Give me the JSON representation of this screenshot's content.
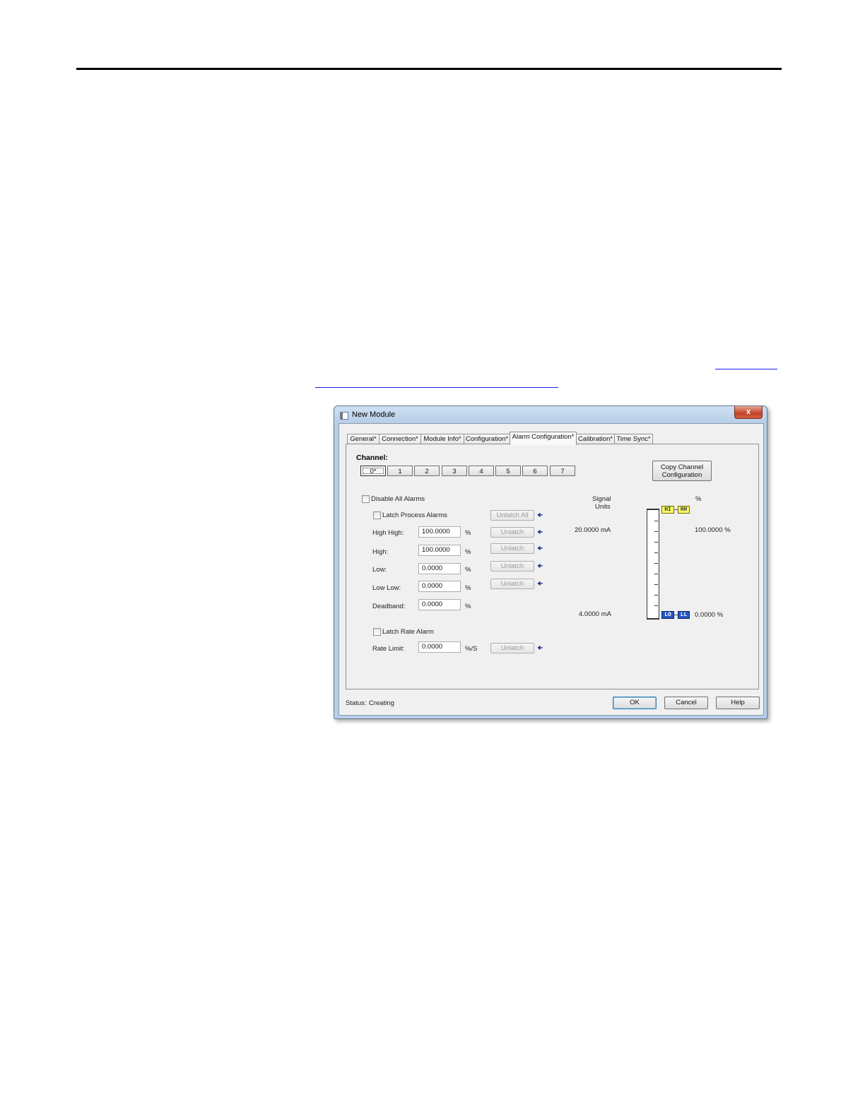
{
  "window": {
    "title": "New Module",
    "close_glyph": "x"
  },
  "tabs": [
    "General*",
    "Connection*",
    "Module Info*",
    "Configuration*",
    "Alarm Configuration*",
    "Calibration*",
    "Time Sync*"
  ],
  "active_tab": "Alarm Configuration*",
  "channel": {
    "label": "Channel:",
    "buttons": [
      "0*",
      "1",
      "2",
      "3",
      "4",
      "5",
      "6",
      "7"
    ],
    "selected": "0*"
  },
  "copy_button": {
    "line1": "Copy Channel",
    "line2": "Configuration"
  },
  "alarms": {
    "disable_all": "Disable All Alarms",
    "latch_process": "Latch Process Alarms",
    "unlatch_all": "Unlatch All",
    "unlatch": "Unlatch",
    "high_high": {
      "label": "High High:",
      "value": "100.0000",
      "unit": "%"
    },
    "high": {
      "label": "High:",
      "value": "100.0000",
      "unit": "%"
    },
    "low": {
      "label": "Low:",
      "value": "0.0000",
      "unit": "%"
    },
    "low_low": {
      "label": "Low Low:",
      "value": "0.0000",
      "unit": "%"
    },
    "deadband": {
      "label": "Deadband:",
      "value": "0.0000",
      "unit": "%"
    },
    "latch_rate": "Latch Rate Alarm",
    "rate_limit": {
      "label": "Rate Limit:",
      "value": "0.0000",
      "unit": "%/S"
    }
  },
  "scale": {
    "signal_units_1": "Signal",
    "signal_units_2": "Units",
    "percent_header": "%",
    "high_signal": "20.0000 mA",
    "low_signal": "4.0000 mA",
    "high_percent": "100.0000 %",
    "low_percent": "0.0000 %",
    "markers": {
      "hi": "HI",
      "hh": "HH",
      "lo": "LO",
      "ll": "LL"
    },
    "colors": {
      "high_marker": "#ffff66",
      "low_marker": "#2456c8"
    }
  },
  "status": {
    "label": "Status:",
    "value": "Creating"
  },
  "footer_buttons": {
    "ok": "OK",
    "cancel": "Cancel",
    "help": "Help"
  }
}
